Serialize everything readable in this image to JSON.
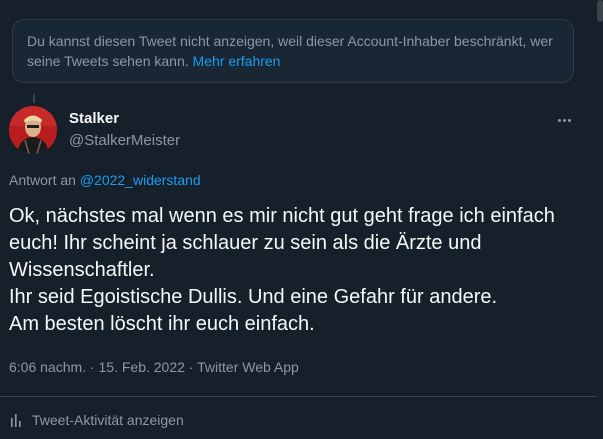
{
  "notice": {
    "text": "Du kannst diesen Tweet nicht anzeigen, weil dieser Account-Inhaber beschränkt, wer seine Tweets sehen kann.",
    "link": "Mehr erfahren"
  },
  "author": {
    "name": "Stalker",
    "handle": "@StalkerMeister",
    "avatar_icon": "profile-avatar"
  },
  "reply": {
    "prefix": "Antwort an",
    "mention": "@2022_widerstand"
  },
  "tweet": {
    "text": "Ok, nächstes mal wenn es mir nicht gut geht frage ich einfach euch! Ihr scheint ja schlauer zu sein als die Ärzte und Wissenschaftler.\nIhr seid Egoistische Dullis. Und eine Gefahr für andere.\nAm besten löscht ihr euch einfach."
  },
  "meta": {
    "time": "6:06 nachm.",
    "date": "15. Feb. 2022",
    "source": "Twitter Web App",
    "separator": " · "
  },
  "activity": {
    "label": "Tweet-Aktivität anzeigen",
    "icon": "bar-chart-icon"
  },
  "colors": {
    "background": "#15202b",
    "accent": "#1d9bf0",
    "text": "#f7f9f9",
    "secondary": "#8b98a5"
  }
}
